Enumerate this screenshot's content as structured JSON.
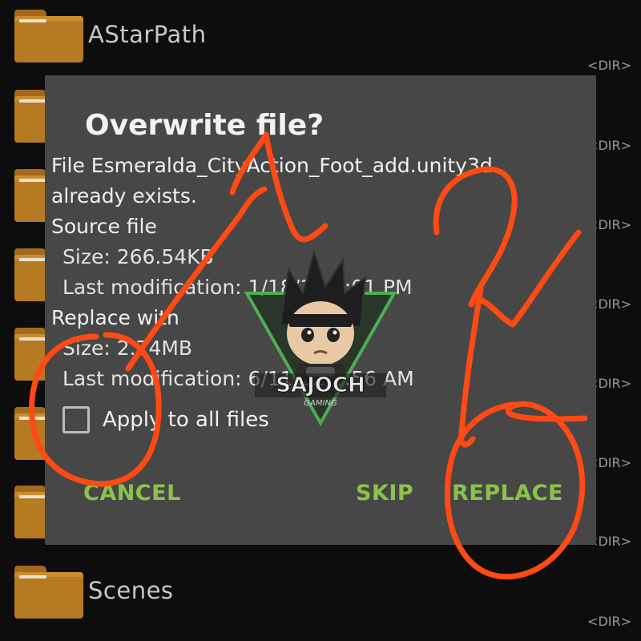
{
  "file_list": [
    {
      "name": "AStarPath",
      "tag": ""
    },
    {
      "name": "",
      "tag": "<DIR>"
    },
    {
      "name": "",
      "tag": "<DIR>"
    },
    {
      "name": "",
      "tag": "<DIR>"
    },
    {
      "name": "",
      "tag": "<DIR>"
    },
    {
      "name": "",
      "tag": "<DIR>"
    },
    {
      "name": "",
      "tag": "<DIR>"
    },
    {
      "name": "Scenes",
      "tag": "<DIR>"
    }
  ],
  "first_dir_tag": "<DIR>",
  "dialog": {
    "title": "Overwrite file?",
    "line1": "File Esmeralda_CityAction_Foot_add.unity3d",
    "line2": "already exists.",
    "source_heading": "Source file",
    "source_size": "Size: 266.54KB",
    "source_modified": "Last modification: 1/18/16 1:01 PM",
    "replace_heading": "Replace with",
    "replace_size": "Size: 2.74MB",
    "replace_modified": "Last modification: 6/11/22 2:56 AM",
    "apply_all_label": "Apply to all files",
    "apply_all_checked": false,
    "buttons": {
      "cancel": "CANCEL",
      "skip": "SKIP",
      "replace": "REPLACE"
    }
  },
  "watermark": {
    "text": "SAJOCH",
    "subtext": "GAMING"
  },
  "colors": {
    "dialog_bg": "#474747",
    "button_text": "#8bc34a",
    "annotation": "#ff4a14",
    "folder": "#b57a22"
  }
}
